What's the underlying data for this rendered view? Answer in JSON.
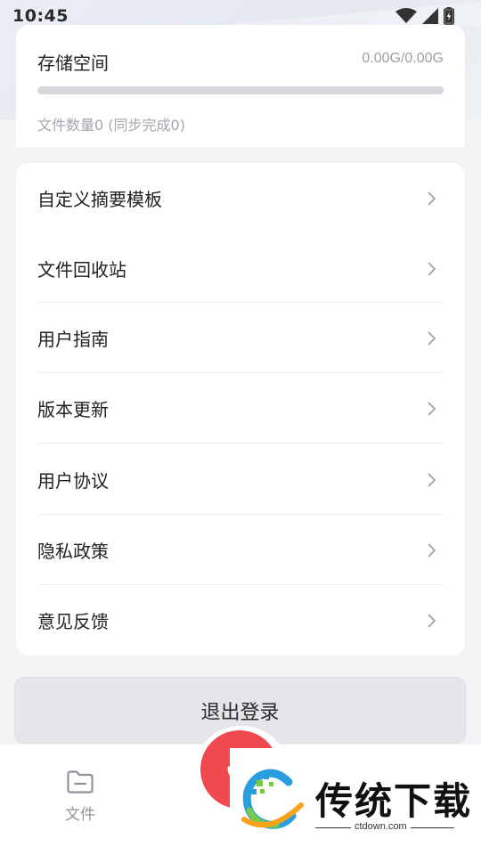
{
  "status_bar": {
    "time": "10:45",
    "icons": [
      "wifi-icon",
      "cell-signal-icon",
      "battery-charging-icon"
    ]
  },
  "storage": {
    "title": "存储空间",
    "value": "0.00G/0.00G",
    "used_fraction": 0,
    "file_count": "文件数量0 (同步完成0)"
  },
  "menu": {
    "items": [
      {
        "label": "自定义摘要模板",
        "icon": "chevron-right-icon"
      },
      {
        "label": "文件回收站",
        "icon": "chevron-right-icon"
      },
      {
        "label": "用户指南",
        "icon": "chevron-right-icon"
      },
      {
        "label": "版本更新",
        "icon": "chevron-right-icon"
      },
      {
        "label": "用户协议",
        "icon": "chevron-right-icon"
      },
      {
        "label": "隐私政策",
        "icon": "chevron-right-icon"
      },
      {
        "label": "意见反馈",
        "icon": "chevron-right-icon"
      }
    ]
  },
  "logout": {
    "label": "退出登录"
  },
  "bottom_nav": {
    "files_label": "文件",
    "files_icon": "folder-icon",
    "record_icon": "microphone-icon",
    "record_color": "#ef4a4f"
  },
  "watermark": {
    "text": "传统下载",
    "url": "ctdown.com"
  }
}
